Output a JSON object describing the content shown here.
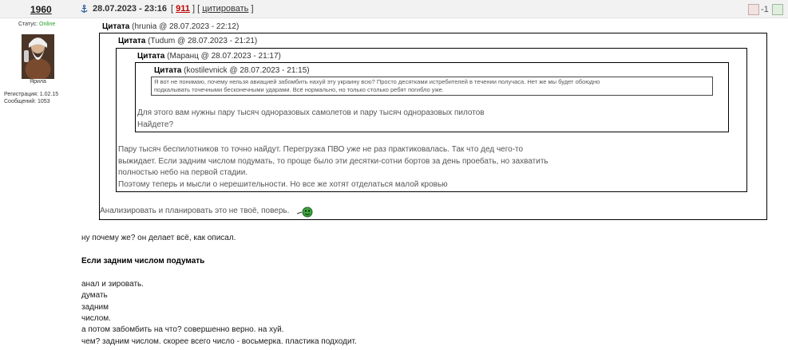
{
  "header": {
    "username": "1960",
    "date": "28.07.2023 - 23:16",
    "post_number": "911",
    "open_bracket": "[",
    "close_bracket": "]",
    "cite_link": "цитировать",
    "rating": "-1",
    "icons": {
      "anchor": "anchor-icon",
      "rate_down": "thumb-down-icon",
      "rate_up": "thumb-up-icon"
    }
  },
  "user": {
    "status_label": "Статус:",
    "status_value": "Online",
    "rank": "Ярила",
    "registration": "Регистрация: 1.02.15",
    "messages": "Сообщений: 1053",
    "colors": {
      "online": "#1f9e1f",
      "post_number": "#c00000"
    }
  },
  "quotes": {
    "q1": {
      "label": "Цитата",
      "meta": "(hrunia @ 28.07.2023 - 22:12)",
      "text": "Анализировать и планировать это не твоё, поверь.",
      "smiley": "smiley-icon"
    },
    "q2": {
      "label": "Цитата",
      "meta": "(Tudum @ 28.07.2023 - 21:21)",
      "lines": [
        "Пару тысяч беспилотников то точно найдут. Перегрузка ПВО уже не раз практиковалась. Так что дед чего-то",
        "выжидает. Если задним числом подумать, то проще было эти десятки-сотни бортов за день проебать, но захватить",
        "полностью небо на первой стадии.",
        "Поэтому теперь и мысли о нерешительности. Но все же хотят отделаться малой кровью"
      ]
    },
    "q3": {
      "label": "Цитата",
      "meta": "(Маранц @ 28.07.2023 - 21:17)",
      "lines": [
        "Для этого вам нужны пару тысяч одноразовых самолетов и пару тысяч одноразовых пилотов",
        "Найдете?"
      ]
    },
    "q4": {
      "label": "Цитата",
      "meta": "(kostilevnick @ 28.07.2023 - 21:15)",
      "lines": [
        "Я вот не понимаю, почему нельзя авиацией забомбить нахуй эту украину всю? Просто десятками истребителей в течении получаса. Нет же мы будет обоюдно",
        "подкалывать точечными бесконечными ударами. Всё нормально, но только столько ребят погибло уже."
      ]
    }
  },
  "body_lines": [
    "ну почему же? он делает всё, как описал.",
    "Если задним числом подумать",
    "анал и зировать.",
    "думать",
    "задним",
    "числом.",
    "а потом забомбить на что? совершенно верно. на хуй.",
    "чем? задним числом. скорее всего число - восьмерка. пластика подходит."
  ]
}
